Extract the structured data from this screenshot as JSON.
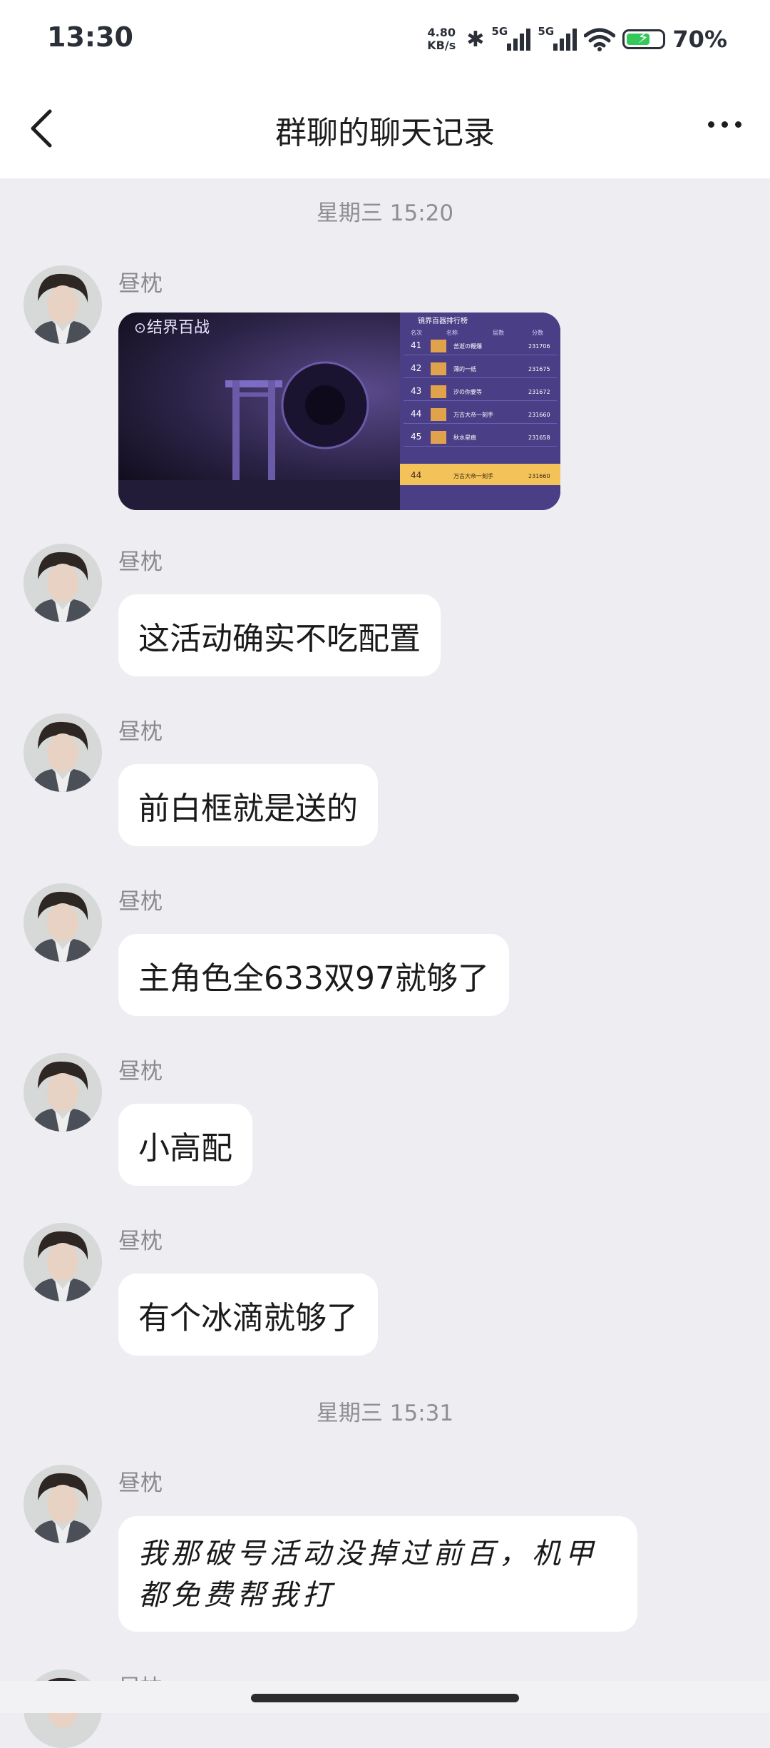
{
  "status_bar": {
    "time": "13:30",
    "net_speed_value": "4.80",
    "net_speed_unit": "KB/s",
    "sim1_label": "5G",
    "sim2_label": "5G",
    "battery_percent": "70%",
    "battery_level": 0.7
  },
  "nav": {
    "title": "群聊的聊天记录",
    "back_icon": "chevron-left-icon",
    "more_icon": "more-dots-icon"
  },
  "timestamps": [
    "星期三 15:20",
    "星期三 15:31"
  ],
  "messages": [
    {
      "sender": "昼枕",
      "type": "image",
      "image": {
        "game_title": "结界百战",
        "leaderboard_title": "镜界百器排行榜",
        "headers": [
          "名次",
          "名称",
          "层数",
          "分数"
        ],
        "rows": [
          [
            "41",
            "苦逝の鞭爆",
            "231706"
          ],
          [
            "42",
            "薄的一纸",
            "231675"
          ],
          [
            "43",
            "汐の你要等",
            "231672"
          ],
          [
            "44",
            "万古大帝一刻手",
            "231660"
          ],
          [
            "45",
            "秋水星痕",
            "231658"
          ]
        ],
        "self_row": [
          "44",
          "万古大帝一刻手",
          "231660"
        ]
      }
    },
    {
      "sender": "昼枕",
      "type": "text",
      "text": "这活动确实不吃配置"
    },
    {
      "sender": "昼枕",
      "type": "text",
      "text": "前白框就是送的"
    },
    {
      "sender": "昼枕",
      "type": "text",
      "text": "主角色全633双97就够了"
    },
    {
      "sender": "昼枕",
      "type": "text",
      "text": "小高配"
    },
    {
      "sender": "昼枕",
      "type": "text",
      "text": "有个冰滴就够了"
    },
    {
      "sender": "昼枕",
      "type": "text",
      "text": "我那破号活动没掉过前百，机甲都免费帮我打"
    },
    {
      "sender": "昼枕",
      "type": "partial"
    }
  ],
  "colors": {
    "background": "#eeeef2",
    "bubble": "#ffffff",
    "battery_green": "#35c759",
    "leaderboard_highlight": "#f3c35a"
  }
}
